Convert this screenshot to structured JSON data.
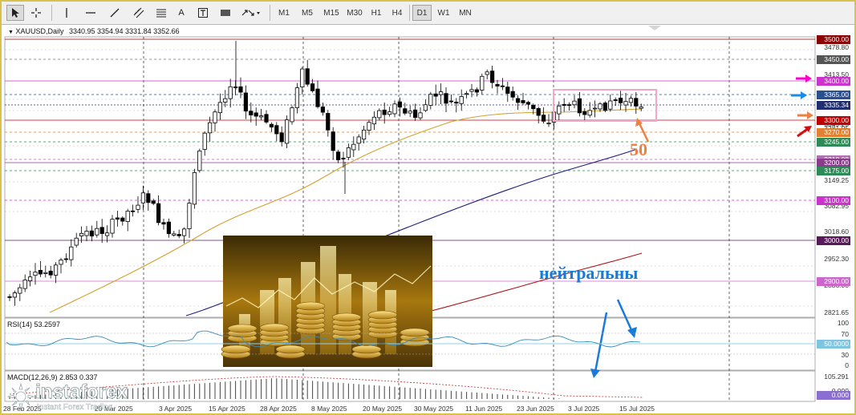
{
  "toolbar": {
    "timeframes": [
      "M1",
      "M5",
      "M15",
      "M30",
      "H1",
      "H4",
      "D1",
      "W1",
      "MN"
    ],
    "text_tool": "A"
  },
  "chart": {
    "header": "XAUUSD,Daily",
    "ohlc": "3340.95 3354.94 3331.84 3352.66",
    "price_scale": [
      "3478.80",
      "3413.50",
      "3349.25",
      "3281.95",
      "3149.25",
      "3082.95",
      "3018.60",
      "2952.30",
      "2886.00",
      "2821.65"
    ],
    "level_labels": [
      {
        "text": "3500.00",
        "color": "#8b0000"
      },
      {
        "text": "3450.00",
        "color": "#555555"
      },
      {
        "text": "3400.00",
        "color": "#cc33cc"
      },
      {
        "text": "3365.00",
        "color": "#2a4f8f"
      },
      {
        "text": "3335.34",
        "color": "#1f2f6f"
      },
      {
        "text": "3300.00",
        "color": "#c00000"
      },
      {
        "text": "3270.00",
        "color": "#e08030"
      },
      {
        "text": "3245.00",
        "color": "#2e8b57"
      },
      {
        "text": "3210.00",
        "color": "#b070b0"
      },
      {
        "text": "3200.00",
        "color": "#8a3c8a"
      },
      {
        "text": "3175.00",
        "color": "#2e8b57"
      },
      {
        "text": "3100.00",
        "color": "#cc33cc"
      },
      {
        "text": "3000.00",
        "color": "#5a1a5a"
      },
      {
        "text": "2900.00",
        "color": "#cc66cc"
      }
    ],
    "dates": [
      "28 Feb 2025",
      "20 Mar 2025",
      "3 Apr 2025",
      "15 Apr 2025",
      "28 Apr 2025",
      "8 May 2025",
      "20 May 2025",
      "30 May 2025",
      "11 Jun 2025",
      "23 Jun 2025",
      "3 Jul 2025",
      "15 Jul 2025"
    ],
    "annotation_number": "50",
    "annotation_text": "нейтральны"
  },
  "rsi": {
    "title": "RSI(14) 53.2597",
    "scale": [
      "100",
      "70",
      "30",
      "0"
    ],
    "level_label": "50.0000"
  },
  "macd": {
    "title": "MACD(12,26,9) 2.853 0.337",
    "scale_top": "105.291",
    "scale_mid": "0.000",
    "level_label": "0.000"
  },
  "watermark": {
    "brand": "instaforex",
    "tagline": "Instant Forex Trading"
  },
  "colors": {
    "ma_short": "#d4a030",
    "ma_mid": "#1c1c7c",
    "ma_long": "#b01010",
    "rsi_line": "#3d8bb5",
    "annotation_orange": "#f08040",
    "annotation_blue": "#1a7ad8"
  }
}
